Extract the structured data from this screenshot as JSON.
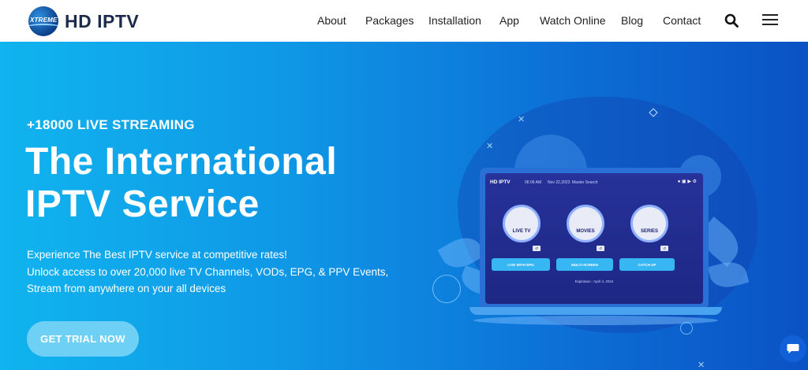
{
  "header": {
    "brand_badge": "XTREME",
    "brand_name": "HD IPTV",
    "nav": [
      {
        "label": "About"
      },
      {
        "label": "Packages"
      },
      {
        "label": "Installation"
      },
      {
        "label": "App"
      },
      {
        "label": "Watch Online"
      },
      {
        "label": "Blog"
      },
      {
        "label": "Contact"
      }
    ],
    "search_icon": "search-icon",
    "menu_icon": "hamburger-menu-icon"
  },
  "hero": {
    "eyebrow": "+18000 LIVE STREAMING",
    "title_line1": "The International",
    "title_line2": "IPTV Service",
    "desc_line1": "Experience The Best IPTV service at competitive rates!",
    "desc_line2": "Unlock access to over 20,000 live TV Channels, VODs, EPG, & PPV Events,",
    "desc_line3": "Stream from anywhere on your all devices",
    "cta_label": "GET TRIAL NOW",
    "colors": {
      "gradient_start": "#10b4ef",
      "gradient_end": "#0b52c4",
      "cta_bg": "#6fd0f5"
    }
  },
  "illustration": {
    "app_name": "HD IPTV",
    "time": "06:06 AM",
    "date": "Nov 22,2023",
    "user": "Master Search",
    "tiles": [
      {
        "label": "LIVE TV"
      },
      {
        "label": "MOVIES"
      },
      {
        "label": "SERIES"
      }
    ],
    "buttons": [
      {
        "label": "LIVE WITH EPG"
      },
      {
        "label": "MULTI-SCREEN"
      },
      {
        "label": "CATCH UP"
      }
    ],
    "expiration": "Expiration : April 4, 2024"
  },
  "chat_icon": "chat-bubble-icon"
}
